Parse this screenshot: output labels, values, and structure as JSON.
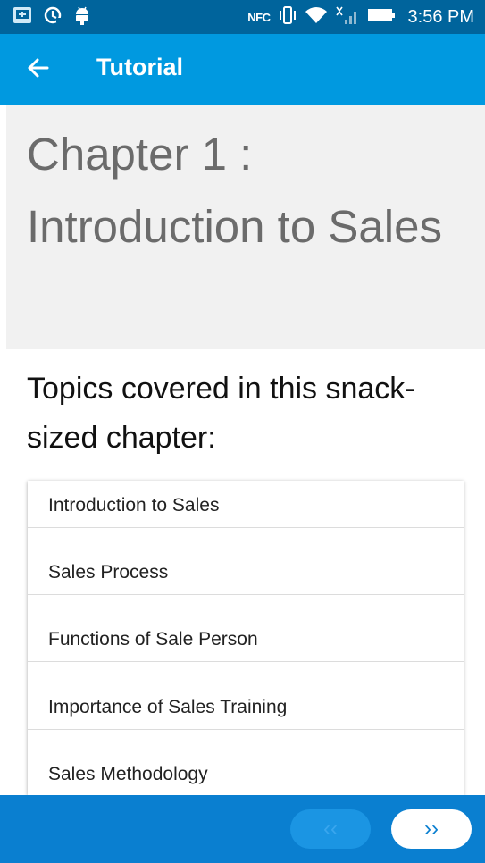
{
  "status_bar": {
    "time": "3:56 PM",
    "nfc_label": "NFC",
    "icons": [
      "screen-cast-icon",
      "data-saver-icon",
      "android-icon",
      "nfc-icon",
      "vibrate-icon",
      "wifi-icon",
      "signal-icon",
      "battery-icon"
    ]
  },
  "app_bar": {
    "title": "Tutorial",
    "back_icon": "arrow-back-icon"
  },
  "chapter": {
    "title": "Chapter 1 : Introduction to Sales"
  },
  "topics": {
    "heading": "Topics covered in this snack-sized chapter:",
    "items": [
      {
        "label": "Introduction to Sales"
      },
      {
        "label": "Sales Process"
      },
      {
        "label": "Functions of Sale Person"
      },
      {
        "label": "Importance of Sales Training"
      },
      {
        "label": "Sales Methodology"
      }
    ]
  },
  "navigation": {
    "prev_label": "‹‹",
    "next_label": "››",
    "prev_enabled": false
  },
  "colors": {
    "status_bar": "#00649c",
    "app_bar": "#0099e0",
    "bottom_bar": "#0a7fd0",
    "chapter_bg": "#f1f1f1"
  }
}
